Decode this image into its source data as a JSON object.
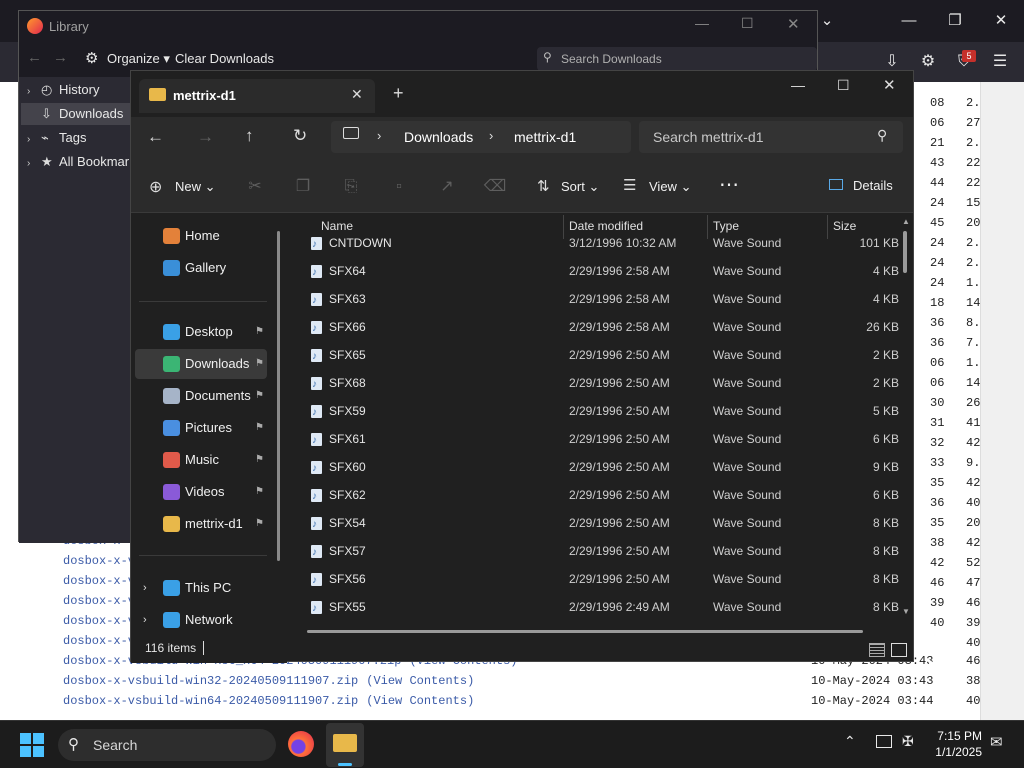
{
  "browser": {
    "tray_badge_count": "5"
  },
  "page": {
    "col1_numbers": [
      "08",
      "06",
      "21",
      "43",
      "44",
      "24",
      "45",
      "24",
      "24",
      "24",
      "18",
      "36",
      "36",
      "06",
      "06",
      "30",
      "31",
      "32",
      "33",
      "35",
      "36",
      "35",
      "38",
      "42",
      "46",
      "39",
      "40"
    ],
    "col2_numbers": [
      "2.",
      "27",
      "2.",
      "22",
      "22",
      "15",
      "20",
      "2.",
      "2.",
      "1.",
      "14",
      "8.",
      "7.",
      "1.",
      "14",
      "26",
      "41",
      "42",
      "9.",
      "42",
      "40",
      "20",
      "42",
      "52",
      "47",
      "46",
      "39",
      "40"
    ],
    "links": [
      {
        "name": "dosbox-x-",
        "contents": "",
        "date": ""
      },
      {
        "name": "dosbox-x-v",
        "contents": "",
        "date": ""
      },
      {
        "name": "dosbox-x-v",
        "contents": "",
        "date": ""
      },
      {
        "name": "dosbox-x-v",
        "contents": "",
        "date": ""
      },
      {
        "name": "dosbox-x-v",
        "contents": "",
        "date": ""
      },
      {
        "name": "dosbox-x-v",
        "contents": "",
        "date": ""
      },
      {
        "name": "dosbox-x-vsbuild-win-x86_x64-20240509111907.zip",
        "contents": "(View Contents)",
        "date": "10-May-2024 03:43"
      },
      {
        "name": "dosbox-x-vsbuild-win32-20240509111907.zip",
        "contents": "(View Contents)",
        "date": "10-May-2024 03:43"
      },
      {
        "name": "dosbox-x-vsbuild-win64-20240509111907.zip",
        "contents": "(View Contents)",
        "date": "10-May-2024 03:44"
      }
    ],
    "link_nums": [
      "46",
      "38",
      "40"
    ]
  },
  "library": {
    "title": "Library",
    "organize": "Organize",
    "clear_downloads": "Clear Downloads",
    "search_placeholder": "Search Downloads",
    "tree": [
      {
        "label": "History",
        "icon": "clock-icon"
      },
      {
        "label": "Downloads",
        "icon": "download-icon"
      },
      {
        "label": "Tags",
        "icon": "tag-icon"
      },
      {
        "label": "All Bookmarks",
        "icon": "star-icon"
      }
    ]
  },
  "explorer": {
    "tab_title": "mettrix-d1",
    "breadcrumb": [
      "Downloads",
      "mettrix-d1"
    ],
    "search_placeholder": "Search mettrix-d1",
    "cmd": {
      "new": "New",
      "sort": "Sort",
      "view": "View",
      "details": "Details"
    },
    "sidebar": [
      {
        "label": "Home",
        "color": "#e3813a"
      },
      {
        "label": "Gallery",
        "color": "#3a8fd8"
      },
      {
        "label": "Desktop",
        "color": "#3aa0e6"
      },
      {
        "label": "Downloads",
        "color": "#3bb574"
      },
      {
        "label": "Documents",
        "color": "#a6b4c8"
      },
      {
        "label": "Pictures",
        "color": "#4a8fe0"
      },
      {
        "label": "Music",
        "color": "#e05a4a"
      },
      {
        "label": "Videos",
        "color": "#8a5ad8"
      },
      {
        "label": "mettrix-d1",
        "color": "#e8b84a"
      },
      {
        "label": "This PC",
        "color": "#3aa0e6"
      },
      {
        "label": "Network",
        "color": "#3aa0e6"
      }
    ],
    "columns": {
      "name": "Name",
      "date": "Date modified",
      "type": "Type",
      "size": "Size"
    },
    "files": [
      {
        "name": "CNTDOWN",
        "date": "3/12/1996 10:32 AM",
        "type": "Wave Sound",
        "size": "101 KB"
      },
      {
        "name": "SFX64",
        "date": "2/29/1996 2:58 AM",
        "type": "Wave Sound",
        "size": "4 KB"
      },
      {
        "name": "SFX63",
        "date": "2/29/1996 2:58 AM",
        "type": "Wave Sound",
        "size": "4 KB"
      },
      {
        "name": "SFX66",
        "date": "2/29/1996 2:58 AM",
        "type": "Wave Sound",
        "size": "26 KB"
      },
      {
        "name": "SFX65",
        "date": "2/29/1996 2:50 AM",
        "type": "Wave Sound",
        "size": "2 KB"
      },
      {
        "name": "SFX68",
        "date": "2/29/1996 2:50 AM",
        "type": "Wave Sound",
        "size": "2 KB"
      },
      {
        "name": "SFX59",
        "date": "2/29/1996 2:50 AM",
        "type": "Wave Sound",
        "size": "5 KB"
      },
      {
        "name": "SFX61",
        "date": "2/29/1996 2:50 AM",
        "type": "Wave Sound",
        "size": "6 KB"
      },
      {
        "name": "SFX60",
        "date": "2/29/1996 2:50 AM",
        "type": "Wave Sound",
        "size": "9 KB"
      },
      {
        "name": "SFX62",
        "date": "2/29/1996 2:50 AM",
        "type": "Wave Sound",
        "size": "6 KB"
      },
      {
        "name": "SFX54",
        "date": "2/29/1996 2:50 AM",
        "type": "Wave Sound",
        "size": "8 KB"
      },
      {
        "name": "SFX57",
        "date": "2/29/1996 2:50 AM",
        "type": "Wave Sound",
        "size": "8 KB"
      },
      {
        "name": "SFX56",
        "date": "2/29/1996 2:50 AM",
        "type": "Wave Sound",
        "size": "8 KB"
      },
      {
        "name": "SFX55",
        "date": "2/29/1996 2:49 AM",
        "type": "Wave Sound",
        "size": "8 KB"
      }
    ],
    "status": "116 items"
  },
  "taskbar": {
    "search": "Search",
    "time": "7:15 PM",
    "date": "1/1/2025"
  }
}
